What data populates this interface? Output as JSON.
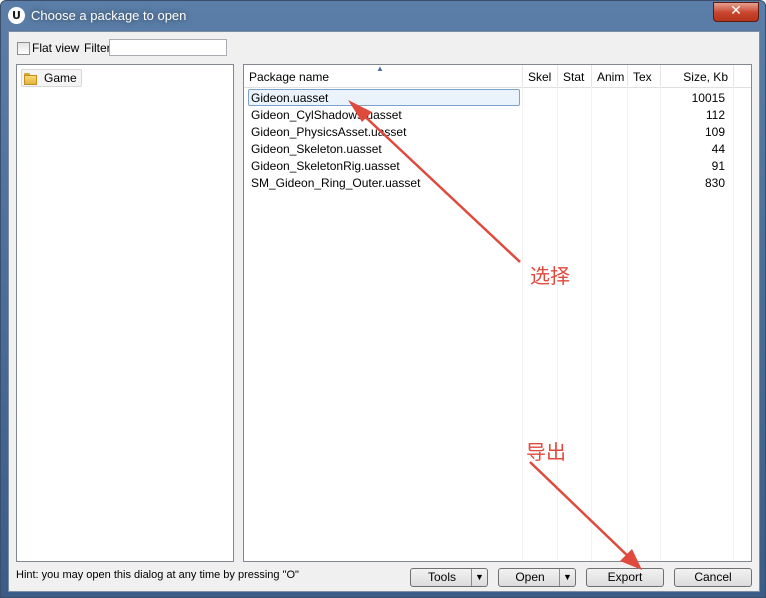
{
  "window": {
    "title": "Choose a package to open",
    "close_glyph": "✕",
    "app_icon_letter": "U"
  },
  "toolbar": {
    "flat_view_label": "Flat view",
    "flat_view_checked": false,
    "filter_label": "Filter:",
    "filter_value": ""
  },
  "tree": {
    "items": [
      {
        "label": "Game"
      }
    ]
  },
  "list": {
    "columns": [
      "Package name",
      "Skel",
      "Stat",
      "Anim",
      "Tex",
      "Size, Kb"
    ],
    "rows": [
      {
        "name": "Gideon.uasset",
        "size": "10015"
      },
      {
        "name": "Gideon_CylShadows.uasset",
        "size": "112"
      },
      {
        "name": "Gideon_PhysicsAsset.uasset",
        "size": "109"
      },
      {
        "name": "Gideon_Skeleton.uasset",
        "size": "44"
      },
      {
        "name": "Gideon_SkeletonRig.uasset",
        "size": "91"
      },
      {
        "name": "SM_Gideon_Ring_Outer.uasset",
        "size": "830"
      }
    ],
    "selected_row": 0
  },
  "footer": {
    "hint": "Hint: you may open this dialog at any time by pressing \"O\"",
    "tools_label": "Tools",
    "open_label": "Open",
    "export_label": "Export",
    "cancel_label": "Cancel"
  },
  "annotations": {
    "select_text": "选择",
    "export_text": "导出",
    "color": "#e04a3d"
  }
}
